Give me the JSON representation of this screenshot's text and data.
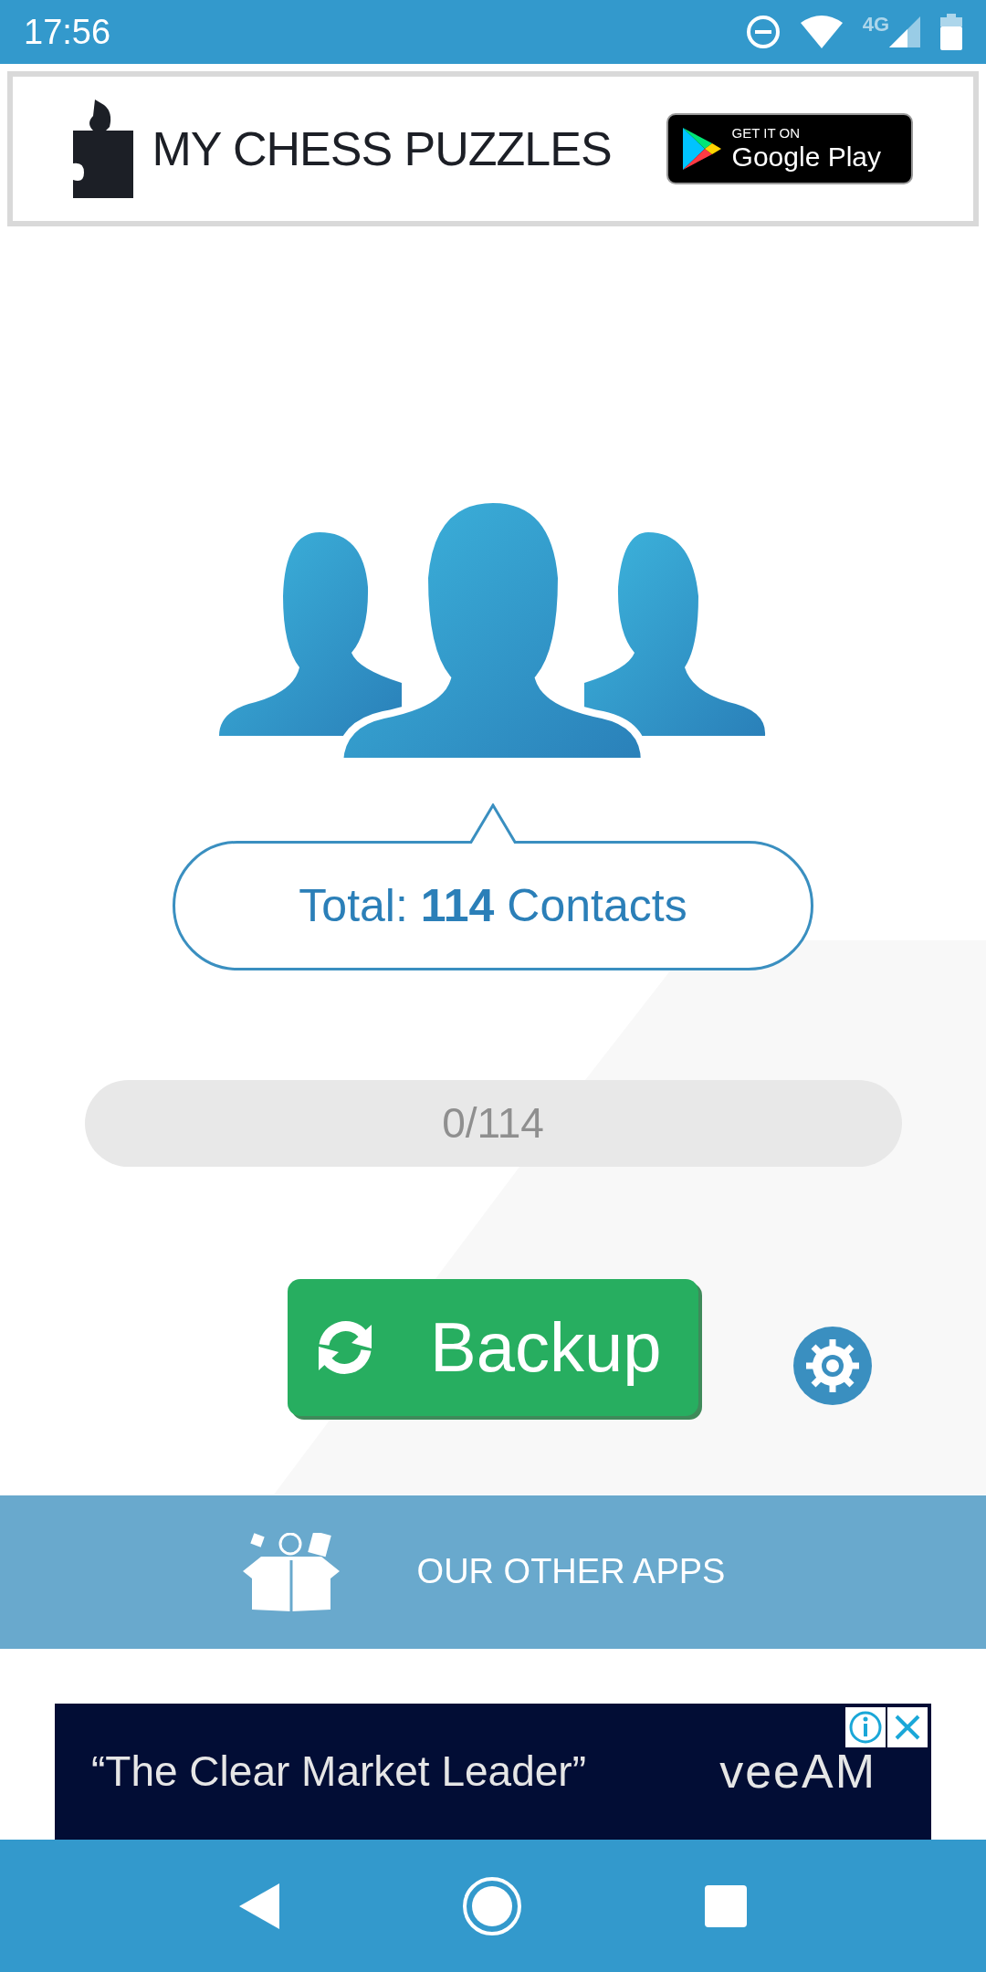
{
  "status_bar": {
    "time": "17:56",
    "network": "4G"
  },
  "top_ad": {
    "brand": "MY CHESS PUZZLES",
    "store_caption": "GET IT ON",
    "store_name": "Google Play"
  },
  "summary": {
    "text": "Total: **114** Contacts"
  },
  "progress": {
    "level": 0,
    "reading": "0/114"
  },
  "backup_button": {
    "label": "Backup"
  },
  "other_apps": {
    "label": "OUR OTHER APPS"
  },
  "bottom_ad": {
    "headline": "“The Clear Market Leader”",
    "brand": "veeAM"
  }
}
